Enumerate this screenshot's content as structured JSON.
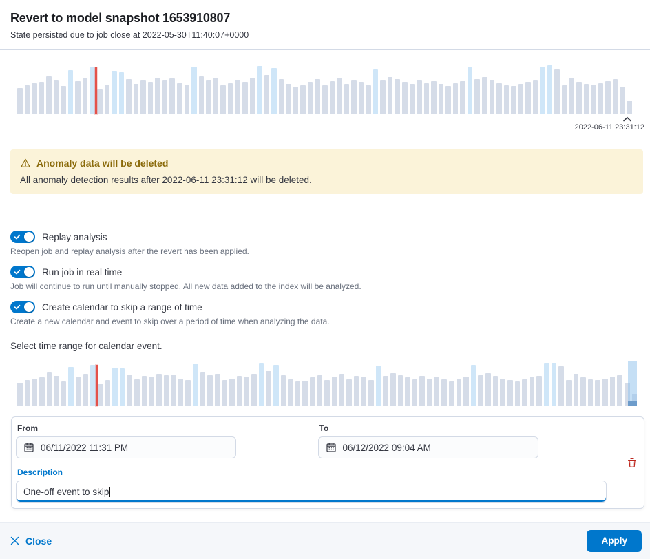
{
  "header": {
    "title": "Revert to model snapshot 1653910807",
    "subtitle": "State persisted due to job close at 2022-05-30T11:40:07+0000"
  },
  "callout": {
    "title": "Anomaly data will be deleted",
    "body": "All anomaly detection results after 2022-06-11 23:31:12 will be deleted."
  },
  "toggles": [
    {
      "label": "Replay analysis",
      "help": "Reopen job and replay analysis after the revert has been applied.",
      "state": "on"
    },
    {
      "label": "Run job in real time",
      "help": "Job will continue to run until manually stopped. All new data added to the index will be analyzed.",
      "state": "on"
    },
    {
      "label": "Create calendar to skip a range of time",
      "help": "Create a new calendar and event to skip over a period of time when analyzing the data.",
      "state": "on"
    }
  ],
  "calendar_section": {
    "prompt": "Select time range for calendar event.",
    "from_label": "From",
    "from_value": "06/11/2022 11:31 PM",
    "to_label": "To",
    "to_value": "06/12/2022 09:04 AM",
    "description_label": "Description",
    "description_value": "One-off event to skip"
  },
  "footer": {
    "close_label": "Close",
    "apply_label": "Apply"
  },
  "icons": [
    "chevron-up-icon",
    "warning-icon",
    "calendar-icon",
    "trash-icon",
    "close-icon",
    "toggle-check-icon"
  ],
  "colors": {
    "primary": "#0077CC",
    "danger": "#BD271E",
    "warning_bg": "#FBF3D9",
    "warning_text": "#8A6A0A",
    "bar": "#D5DCE8",
    "bar_highlight": "#CFE6F8",
    "marker_red": "#E0352B",
    "selection_blue": "#6D9CCB",
    "text": "#343741",
    "subdued_text": "#69707D",
    "border": "#D3DAE6",
    "footer_bg": "#F5F7FA"
  },
  "chart_data": {
    "type": "bar",
    "title": "Job event rate histogram (shown twice: snapshot overview and calendar range selector)",
    "timestamp_label": "2022-06-11 23:31:12",
    "values": [
      52,
      58,
      62,
      65,
      75,
      68,
      56,
      88,
      66,
      72,
      93,
      50,
      59,
      86,
      84,
      70,
      60,
      68,
      64,
      72,
      69,
      71,
      62,
      58,
      94,
      76,
      69,
      72,
      58,
      62,
      68,
      64,
      72,
      96,
      78,
      92,
      70,
      60,
      55,
      57,
      64,
      70,
      58,
      66,
      72,
      60,
      68,
      64,
      58,
      91,
      68,
      74,
      70,
      64,
      60,
      68,
      62,
      66,
      60,
      56,
      62,
      66,
      93,
      70,
      74,
      68,
      62,
      58,
      56,
      60,
      64,
      68,
      95,
      97,
      90,
      58,
      72,
      64,
      60,
      58,
      62,
      66,
      70,
      53,
      28
    ],
    "highlight_indices": [
      7,
      10,
      13,
      14,
      24,
      33,
      35,
      49,
      62,
      72,
      73
    ],
    "marker_fraction": 0.127,
    "selection": {
      "left_frac": 0.985,
      "width_frac": 0.015
    },
    "xlabel": "",
    "ylabel": "",
    "grid": false,
    "legend": false
  }
}
